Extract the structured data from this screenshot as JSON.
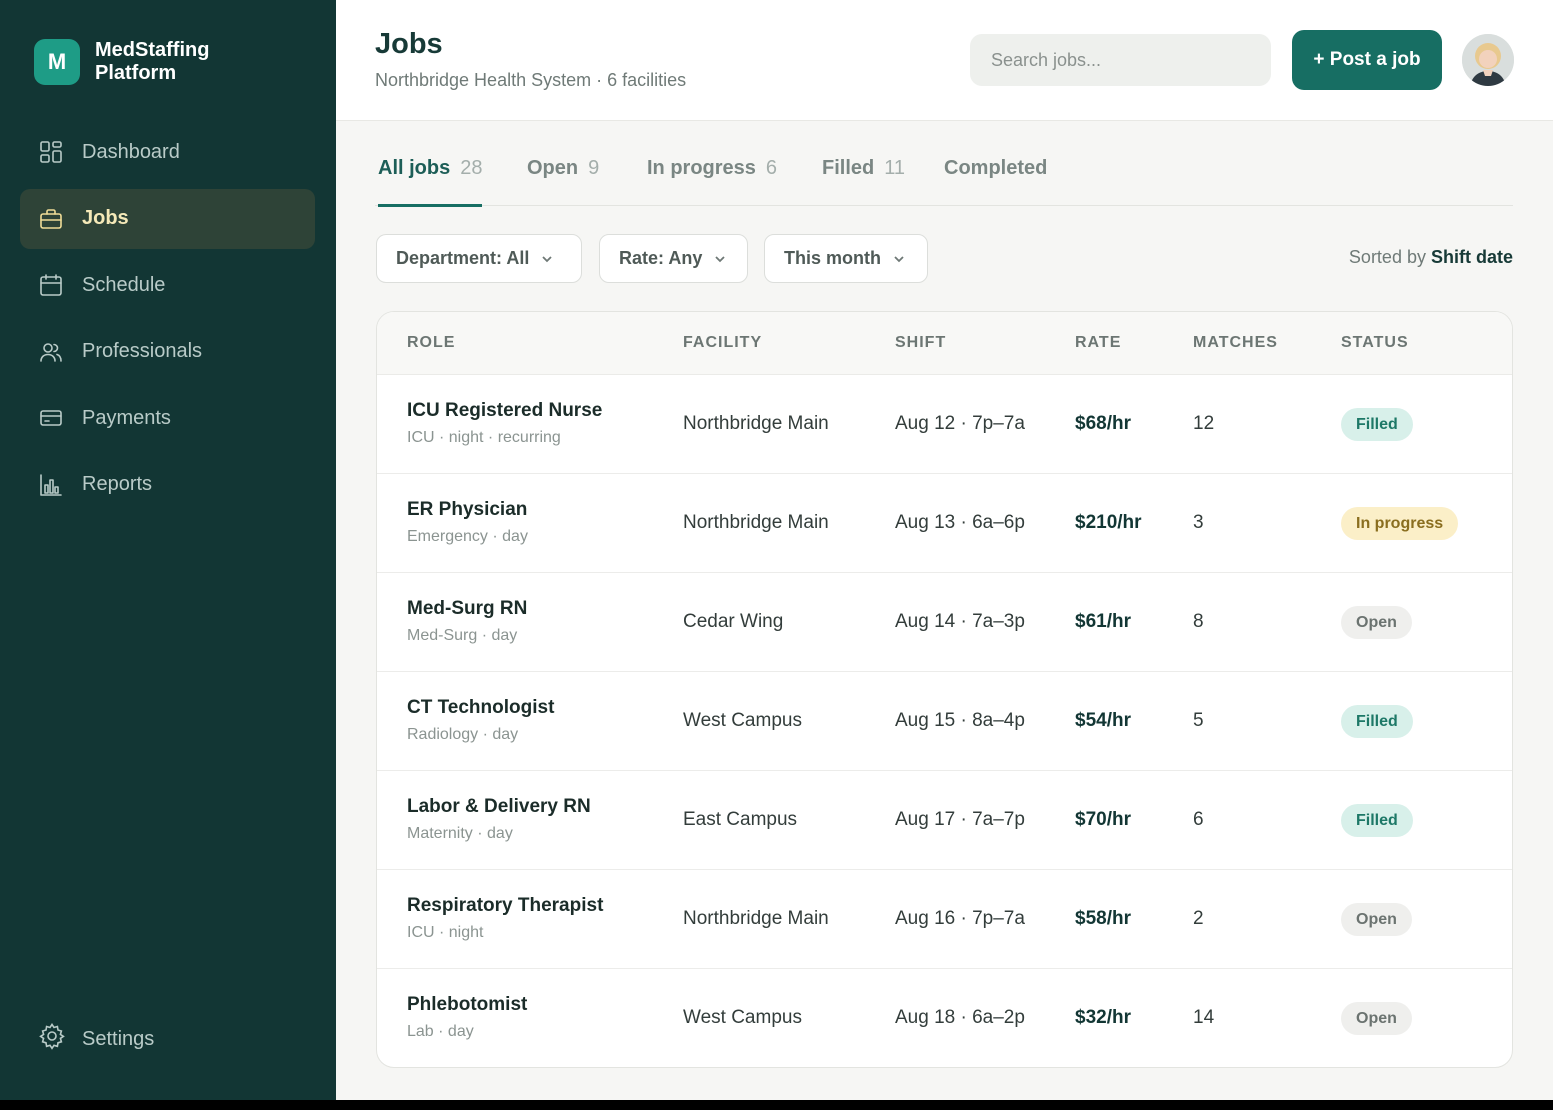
{
  "brand": {
    "logo_letter": "M",
    "name": "MedStaffing Platform"
  },
  "nav": [
    {
      "label": "Dashboard",
      "icon": "grid-icon",
      "active": false
    },
    {
      "label": "Jobs",
      "icon": "briefcase-icon",
      "active": true
    },
    {
      "label": "Schedule",
      "icon": "calendar-icon",
      "active": false
    },
    {
      "label": "Professionals",
      "icon": "users-icon",
      "active": false
    },
    {
      "label": "Payments",
      "icon": "card-icon",
      "active": false
    },
    {
      "label": "Reports",
      "icon": "bar-chart-icon",
      "active": false
    }
  ],
  "settings_label": "Settings",
  "header": {
    "title": "Jobs",
    "subtitle": "Northbridge Health System · 6 facilities",
    "search_placeholder": "Search jobs...",
    "post_button": "+ Post a job"
  },
  "tabs": [
    {
      "label": "All jobs",
      "count": "28",
      "active": true
    },
    {
      "label": "Open",
      "count": "9",
      "active": false
    },
    {
      "label": "In progress",
      "count": "6",
      "active": false
    },
    {
      "label": "Filled",
      "count": "11",
      "active": false
    },
    {
      "label": "Completed",
      "count": "",
      "active": false
    }
  ],
  "filters": [
    {
      "label": "Department: All"
    },
    {
      "label": "Rate: Any"
    },
    {
      "label": "This month"
    }
  ],
  "sort": {
    "prefix": "Sorted by",
    "value": "Shift date"
  },
  "table": {
    "columns": [
      "ROLE",
      "FACILITY",
      "SHIFT",
      "RATE",
      "MATCHES",
      "STATUS"
    ],
    "rows": [
      {
        "role": "ICU Registered Nurse",
        "meta": "ICU · night · recurring",
        "facility": "Northbridge Main",
        "shift": "Aug 12 · 7p–7a",
        "rate": "$68/hr",
        "matches": "12",
        "status": "Filled",
        "status_kind": "filled"
      },
      {
        "role": "ER Physician",
        "meta": "Emergency · day",
        "facility": "Northbridge Main",
        "shift": "Aug 13 · 6a–6p",
        "rate": "$210/hr",
        "matches": "3",
        "status": "In progress",
        "status_kind": "progress"
      },
      {
        "role": "Med-Surg RN",
        "meta": "Med-Surg · day",
        "facility": "Cedar Wing",
        "shift": "Aug 14 · 7a–3p",
        "rate": "$61/hr",
        "matches": "8",
        "status": "Open",
        "status_kind": "open"
      },
      {
        "role": "CT Technologist",
        "meta": "Radiology · day",
        "facility": "West Campus",
        "shift": "Aug 15 · 8a–4p",
        "rate": "$54/hr",
        "matches": "5",
        "status": "Filled",
        "status_kind": "filled"
      },
      {
        "role": "Labor & Delivery RN",
        "meta": "Maternity · day",
        "facility": "East Campus",
        "shift": "Aug 17 · 7a–7p",
        "rate": "$70/hr",
        "matches": "6",
        "status": "Filled",
        "status_kind": "filled"
      },
      {
        "role": "Respiratory Therapist",
        "meta": "ICU · night",
        "facility": "Northbridge Main",
        "shift": "Aug 16 · 7p–7a",
        "rate": "$58/hr",
        "matches": "2",
        "status": "Open",
        "status_kind": "open"
      },
      {
        "role": "Phlebotomist",
        "meta": "Lab · day",
        "facility": "West Campus",
        "shift": "Aug 18 · 6a–2p",
        "rate": "$32/hr",
        "matches": "14",
        "status": "Open",
        "status_kind": "open"
      }
    ]
  },
  "colors": {
    "sidebar": "#123634",
    "accent": "#176e63",
    "active_nav": "#2e4337",
    "filled_badge": "#d8f0ea",
    "progress_badge": "#fbefc8",
    "open_badge": "#efefed"
  }
}
